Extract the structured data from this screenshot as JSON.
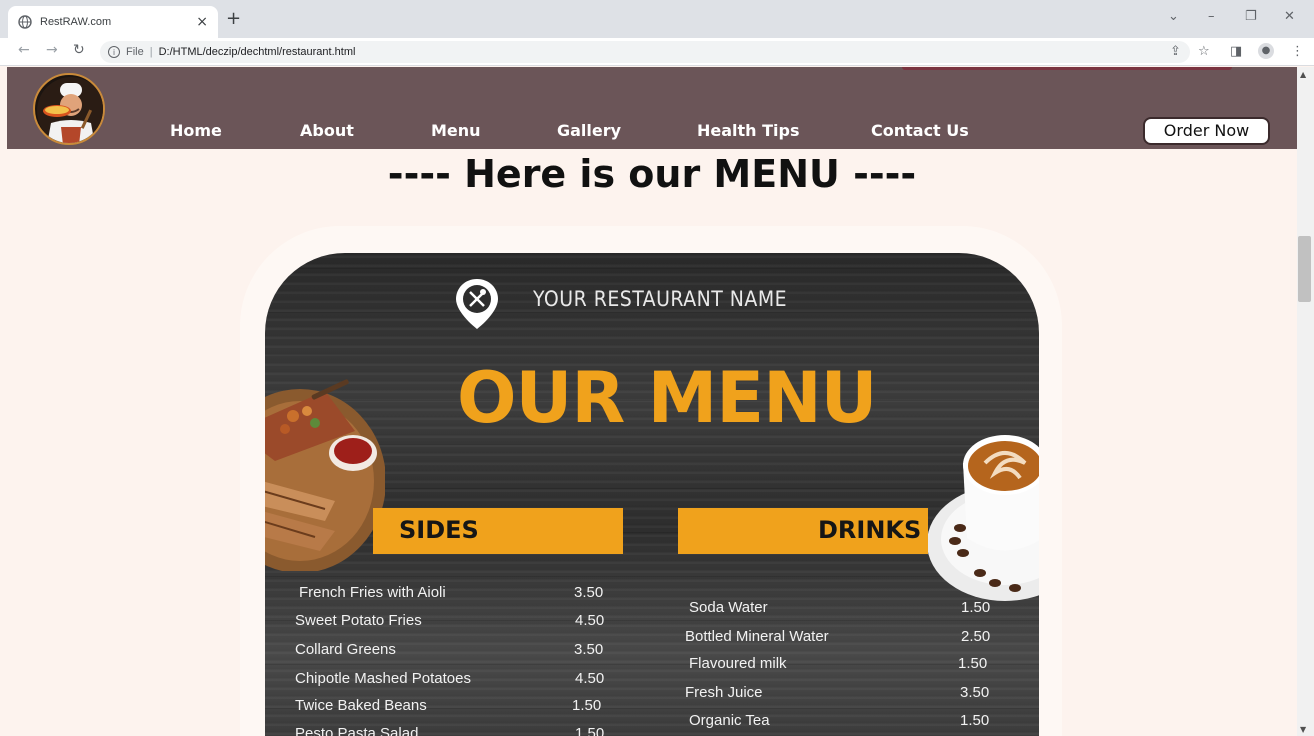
{
  "browser": {
    "tab_title": "RestRAW.com",
    "tab_close": "×",
    "new_tab": "+",
    "scheme": "File",
    "separator": "|",
    "url": "D:/HTML/deczip/dechtml/restaurant.html",
    "icons": [
      "globe-icon",
      "back-icon",
      "forward-icon",
      "reload-icon",
      "info-icon",
      "share-icon",
      "star-icon",
      "sidepanel-icon",
      "profile-icon",
      "kebab-menu-icon",
      "minimize-icon",
      "restore-icon",
      "close-icon",
      "chevron-down-icon"
    ]
  },
  "site": {
    "nav": [
      "Home",
      "About",
      "Menu",
      "Gallery",
      "Health Tips",
      "Contact Us"
    ],
    "order_button": "Order Now",
    "heading": "---- Here is our MENU ----"
  },
  "menu_image": {
    "restaurant_name": "YOUR RESTAURANT NAME",
    "title": "OUR MENU",
    "sides_label": "SIDES",
    "drinks_label": "DRINKS",
    "sides": [
      {
        "name": "French Fries with Aioli",
        "price": "3.50"
      },
      {
        "name": "Sweet Potato Fries",
        "price": "4.50"
      },
      {
        "name": "Collard Greens",
        "price": "3.50"
      },
      {
        "name": "Chipotle Mashed Potatoes",
        "price": "4.50"
      },
      {
        "name": "Twice Baked Beans",
        "price": "1.50"
      },
      {
        "name": "Pesto Pasta Salad",
        "price": "1.50"
      }
    ],
    "drinks": [
      {
        "name": "Soda Water",
        "price": "1.50"
      },
      {
        "name": "Bottled Mineral Water",
        "price": "2.50"
      },
      {
        "name": "Flavoured milk",
        "price": "1.50"
      },
      {
        "name": "Fresh Juice",
        "price": "3.50"
      },
      {
        "name": "Organic Tea",
        "price": "1.50"
      }
    ],
    "colors": {
      "accent": "#f0a21c",
      "board": "#333333"
    }
  },
  "colors": {
    "nav_bg": "#6b5558",
    "page_bg": "#fdf3ee"
  }
}
